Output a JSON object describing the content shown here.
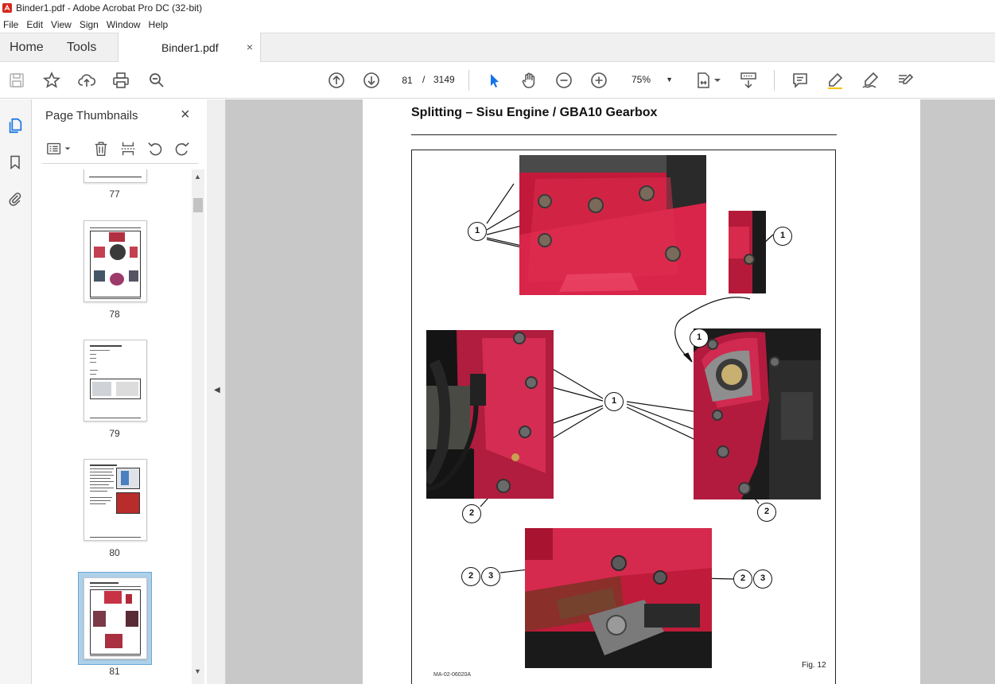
{
  "window": {
    "title": "Binder1.pdf - Adobe Acrobat Pro DC (32-bit)"
  },
  "menu": [
    "File",
    "Edit",
    "View",
    "Sign",
    "Window",
    "Help"
  ],
  "tabs": {
    "home": "Home",
    "tools": "Tools",
    "document": "Binder1.pdf",
    "close": "×"
  },
  "toolbar": {
    "current_page": "81",
    "page_separator": "/",
    "total_pages": "3149",
    "zoom": "75%",
    "icons": [
      "save-icon",
      "star-icon",
      "upload-icon",
      "print-icon",
      "search-icon",
      "page-up-icon",
      "page-down-icon",
      "select-arrow-icon",
      "hand-icon",
      "zoom-out-icon",
      "zoom-in-icon",
      "fit-page-icon",
      "scroll-mode-icon",
      "comment-icon",
      "highlight-icon",
      "sign-icon",
      "fill-sign-icon"
    ]
  },
  "sidebar": {
    "icons": [
      "pages-icon",
      "bookmark-icon",
      "attachment-icon"
    ]
  },
  "thumbnails_panel": {
    "title": "Page Thumbnails",
    "close": "×",
    "pages": [
      {
        "label": "77"
      },
      {
        "label": "78"
      },
      {
        "label": "79"
      },
      {
        "label": "80"
      },
      {
        "label": "81",
        "selected": true
      }
    ]
  },
  "document": {
    "heading": "Splitting – Sisu Engine / GBA10 Gearbox",
    "figure_label": "Fig. 12",
    "figure_code": "MA-02-06020A",
    "callouts": [
      "1",
      "1",
      "1",
      "1",
      "2",
      "2",
      "2",
      "3",
      "2",
      "3"
    ]
  },
  "colors": {
    "accent": "#1473e6",
    "selection": "#aed1ea",
    "doc_bg": "#c8c8c8"
  }
}
